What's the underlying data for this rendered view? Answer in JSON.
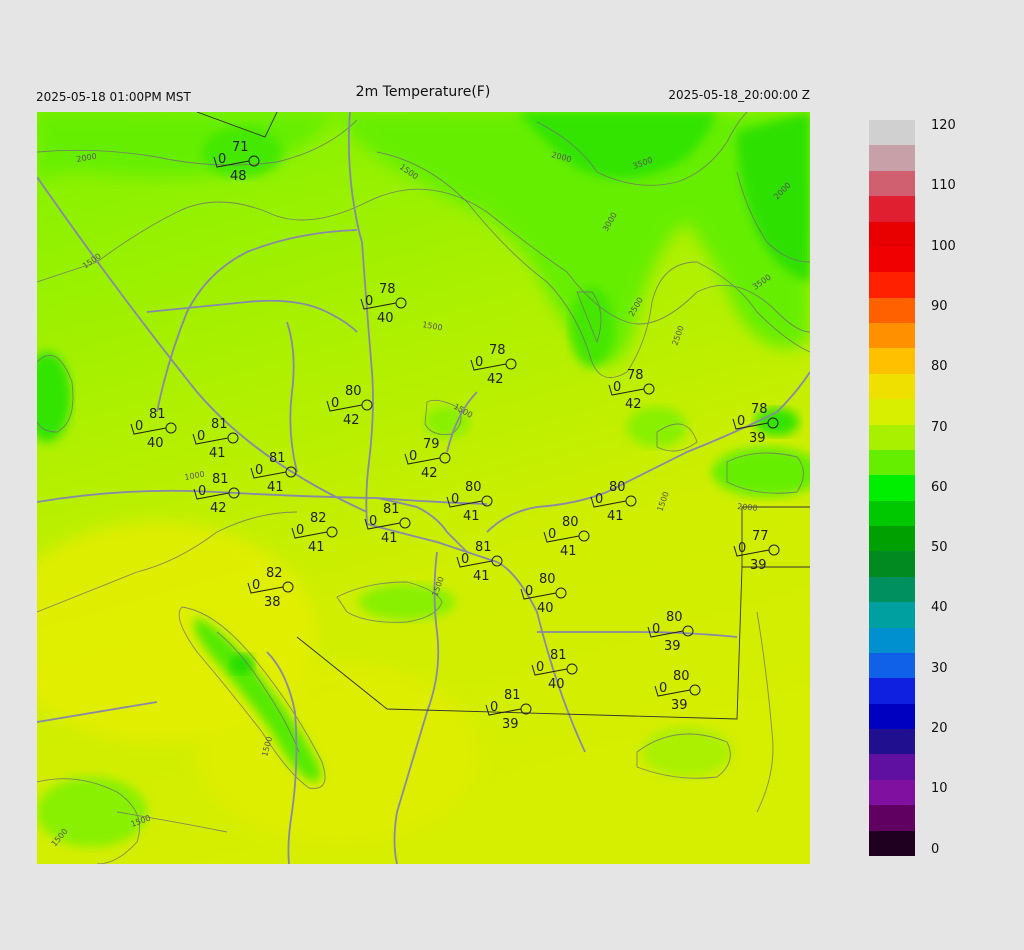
{
  "header": {
    "left": "2025-05-18 01:00PM MST",
    "title": "2m Temperature(F)",
    "right": "2025-05-18_20:00:00 Z"
  },
  "colorbar": {
    "ticks": [
      "120",
      "110",
      "100",
      "90",
      "80",
      "70",
      "60",
      "50",
      "40",
      "30",
      "20",
      "10",
      "0"
    ]
  },
  "contour_labels": [
    "2000",
    "1500",
    "2000",
    "3500",
    "3000",
    "2500",
    "2000",
    "3500",
    "2500",
    "1500",
    "1500",
    "1500",
    "1000",
    "2000",
    "1500",
    "1500",
    "1500",
    "1500",
    "1500"
  ],
  "stations": [
    {
      "t": "71",
      "d": "48",
      "w": "0"
    },
    {
      "t": "78",
      "d": "40",
      "w": "0"
    },
    {
      "t": "78",
      "d": "42",
      "w": "0"
    },
    {
      "t": "80",
      "d": "42",
      "w": "0"
    },
    {
      "t": "81",
      "d": "40",
      "w": "0"
    },
    {
      "t": "81",
      "d": "41",
      "w": "0"
    },
    {
      "t": "81",
      "d": "41",
      "w": "0"
    },
    {
      "t": "81",
      "d": "42",
      "w": "0"
    },
    {
      "t": "79",
      "d": "42",
      "w": "0"
    },
    {
      "t": "78",
      "d": "42",
      "w": "0"
    },
    {
      "t": "78",
      "d": "39",
      "w": "0"
    },
    {
      "t": "80",
      "d": "41",
      "w": "0"
    },
    {
      "t": "81",
      "d": "41",
      "w": "0"
    },
    {
      "t": "82",
      "d": "41",
      "w": "0"
    },
    {
      "t": "80",
      "d": "41",
      "w": "0"
    },
    {
      "t": "80",
      "d": "41",
      "w": "0"
    },
    {
      "t": "81",
      "d": "41",
      "w": "0"
    },
    {
      "t": "82",
      "d": "38",
      "w": "0"
    },
    {
      "t": "80",
      "d": "40",
      "w": "0"
    },
    {
      "t": "77",
      "d": "39",
      "w": "0"
    },
    {
      "t": "80",
      "d": "39",
      "w": "0"
    },
    {
      "t": "81",
      "d": "40",
      "w": "0"
    },
    {
      "t": "80",
      "d": "39",
      "w": "0"
    },
    {
      "t": "81",
      "d": "39",
      "w": "0"
    }
  ]
}
